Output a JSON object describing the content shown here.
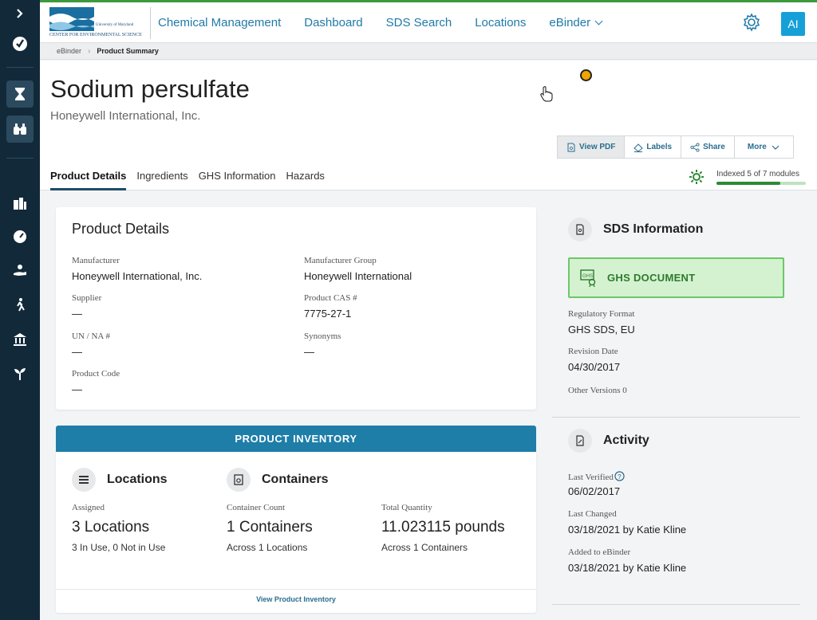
{
  "header": {
    "logo_line1": "University of Maryland",
    "logo_line2": "CENTER FOR ENVIRONMENTAL SCIENCE",
    "nav": [
      "Chemical Management",
      "Dashboard",
      "SDS Search",
      "Locations",
      "eBinder"
    ],
    "avatar": "AI"
  },
  "breadcrumb": [
    "eBinder",
    "Product Summary"
  ],
  "product": {
    "name": "Sodium persulfate",
    "manufacturer_line": "Honeywell International, Inc."
  },
  "actions": [
    "View PDF",
    "Labels",
    "Share",
    "More"
  ],
  "tabs": [
    "Product Details",
    "Ingredients",
    "GHS Information",
    "Hazards"
  ],
  "index_status": {
    "label": "Indexed 5 of 7 modules",
    "progress": 0.714
  },
  "details": {
    "title": "Product Details",
    "fields": [
      {
        "label": "Manufacturer",
        "value": "Honeywell International, Inc."
      },
      {
        "label": "Manufacturer Group",
        "value": "Honeywell International"
      },
      {
        "label": "Supplier",
        "value": "—"
      },
      {
        "label": "Product CAS #",
        "value": "7775-27-1"
      },
      {
        "label": "UN / NA #",
        "value": "—"
      },
      {
        "label": "Synonyms",
        "value": "—"
      },
      {
        "label": "Product Code",
        "value": "—"
      }
    ]
  },
  "inventory": {
    "header": "PRODUCT INVENTORY",
    "locations_title": "Locations",
    "containers_title": "Containers",
    "assigned_label": "Assigned",
    "assigned_value": "3 Locations",
    "assigned_sub": "3 In Use, 0 Not in Use",
    "count_label": "Container Count",
    "count_value": "1 Containers",
    "count_sub": "Across 1 Locations",
    "qty_label": "Total Quantity",
    "qty_value": "11.023115 pounds",
    "qty_sub": "Across 1 Containers",
    "link": "View Product Inventory"
  },
  "sds": {
    "title": "SDS Information",
    "doc_label": "GHS DOCUMENT",
    "format_label": "Regulatory Format",
    "format_value": "GHS SDS, EU",
    "revision_label": "Revision Date",
    "revision_value": "04/30/2017",
    "other_versions": "Other Versions 0"
  },
  "activity": {
    "title": "Activity",
    "verified_label": "Last Verified",
    "verified_value": "06/02/2017",
    "changed_label": "Last Changed",
    "changed_value": "03/18/2021 by Katie Kline",
    "added_label": "Added to eBinder",
    "added_value": "03/18/2021 by Katie Kline"
  },
  "colors": {
    "rail": "#12293a",
    "accent": "#1f7aa6",
    "inventory_header": "#1e7ea8",
    "ghs_green": "#2e7a2e",
    "avatar": "#16a0d8"
  }
}
